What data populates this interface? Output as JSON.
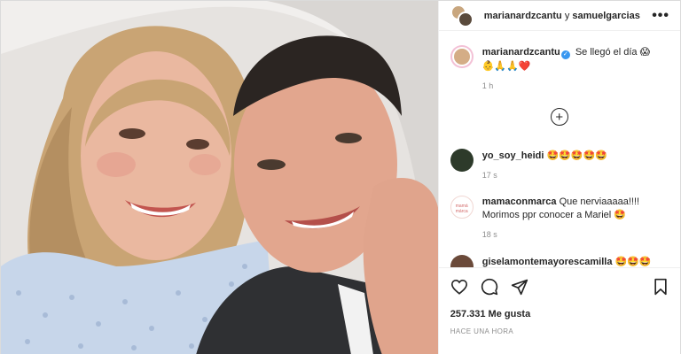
{
  "header": {
    "user1": "marianardzcantu",
    "separator": "y",
    "user2": "samuelgarcias",
    "more_icon": "more-horizontal-icon"
  },
  "caption": {
    "username": "marianardzcantu",
    "text": "Se llegó el día",
    "emoji_end": "😱",
    "emoji_line": "👶🙏🙏❤️",
    "time": "1 h"
  },
  "load_more_icon": "plus-circle-icon",
  "comments": [
    {
      "username": "yo_soy_heidi",
      "text": "🤩🤩🤩🤩🤩",
      "time": "17 s"
    },
    {
      "username": "mamaconmarca",
      "text": "Que nerviaaaaa!!!! Morimos ppr conocer a Mariel 🤩",
      "time": "18 s",
      "avatar_text": "mamá\nmárca"
    },
    {
      "username": "giselamontemayorescamilla",
      "text": "🤩🤩🤩",
      "time": ""
    }
  ],
  "actions": {
    "like_icon": "heart-icon",
    "comment_icon": "comment-icon",
    "share_icon": "send-icon",
    "save_icon": "bookmark-icon"
  },
  "likes": "257.331 Me gusta",
  "posted_ago": "HACE UNA HORA",
  "colors": {
    "text": "#262626",
    "muted": "#8e8e8e",
    "verified": "#3897f0",
    "border": "#efefef"
  }
}
